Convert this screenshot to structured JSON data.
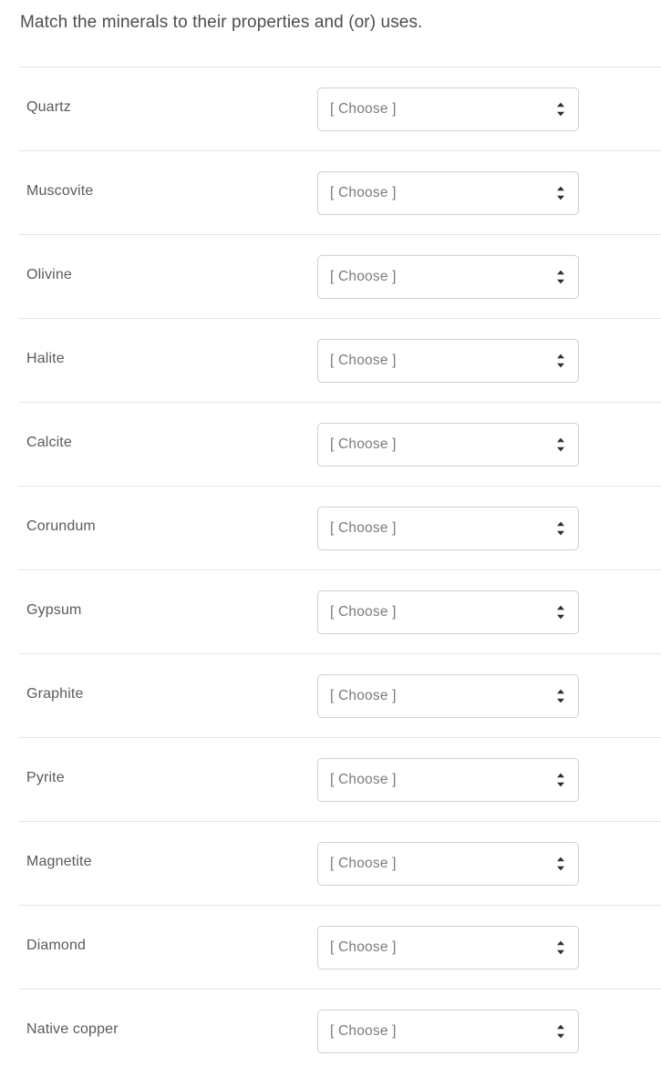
{
  "prompt": {
    "text": "Match the minerals to their properties and (or) uses."
  },
  "select": {
    "placeholder": "[ Choose ]",
    "chevron_icon": "chevron-up-down-icon"
  },
  "colors": {
    "page_background": "#ffffff",
    "prompt_text": "#4d4d4f",
    "label_text": "#5a5a5c",
    "select_placeholder_text": "#7b7b7e",
    "select_border": "#cfcfcf",
    "row_divider": "#e6e6e6",
    "chevron": "#2f2f33"
  },
  "rows": [
    {
      "label": "Quartz",
      "value": "[ Choose ]"
    },
    {
      "label": "Muscovite",
      "value": "[ Choose ]"
    },
    {
      "label": "Olivine",
      "value": "[ Choose ]"
    },
    {
      "label": "Halite",
      "value": "[ Choose ]"
    },
    {
      "label": "Calcite",
      "value": "[ Choose ]"
    },
    {
      "label": "Corundum",
      "value": "[ Choose ]"
    },
    {
      "label": "Gypsum",
      "value": "[ Choose ]"
    },
    {
      "label": "Graphite",
      "value": "[ Choose ]"
    },
    {
      "label": "Pyrite",
      "value": "[ Choose ]"
    },
    {
      "label": "Magnetite",
      "value": "[ Choose ]"
    },
    {
      "label": "Diamond",
      "value": "[ Choose ]"
    },
    {
      "label": "Native copper",
      "value": "[ Choose ]"
    }
  ]
}
